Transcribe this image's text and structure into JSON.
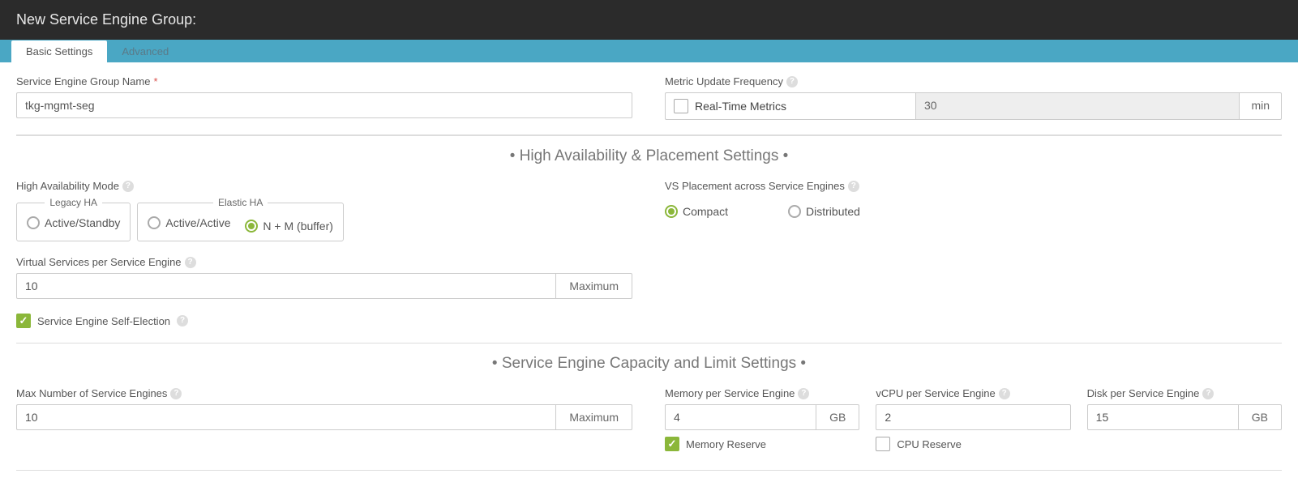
{
  "header": {
    "title": "New Service Engine Group:"
  },
  "tabs": {
    "basic": "Basic Settings",
    "advanced": "Advanced"
  },
  "seg_name": {
    "label": "Service Engine Group Name",
    "value": "tkg-mgmt-seg"
  },
  "metric": {
    "label": "Metric Update Frequency",
    "checkbox": "Real-Time Metrics",
    "value": "30",
    "unit": "min"
  },
  "sections": {
    "ha": "High Availability & Placement Settings",
    "capacity": "Service Engine Capacity and Limit Settings"
  },
  "ha_mode": {
    "label": "High Availability Mode",
    "legacy_legend": "Legacy HA",
    "elastic_legend": "Elastic HA",
    "opt_active_standby": "Active/Standby",
    "opt_active_active": "Active/Active",
    "opt_nm": "N + M (buffer)"
  },
  "vs_placement": {
    "label": "VS Placement across Service Engines",
    "opt_compact": "Compact",
    "opt_distributed": "Distributed"
  },
  "vs_per_se": {
    "label": "Virtual Services per Service Engine",
    "value": "10",
    "addon": "Maximum"
  },
  "self_election": {
    "label": "Service Engine Self-Election"
  },
  "max_se": {
    "label": "Max Number of Service Engines",
    "value": "10",
    "addon": "Maximum"
  },
  "mem_per_se": {
    "label": "Memory per Service Engine",
    "value": "4",
    "unit": "GB"
  },
  "vcpu_per_se": {
    "label": "vCPU per Service Engine",
    "value": "2"
  },
  "disk_per_se": {
    "label": "Disk per Service Engine",
    "value": "15",
    "unit": "GB"
  },
  "mem_reserve": {
    "label": "Memory Reserve"
  },
  "cpu_reserve": {
    "label": "CPU Reserve"
  }
}
